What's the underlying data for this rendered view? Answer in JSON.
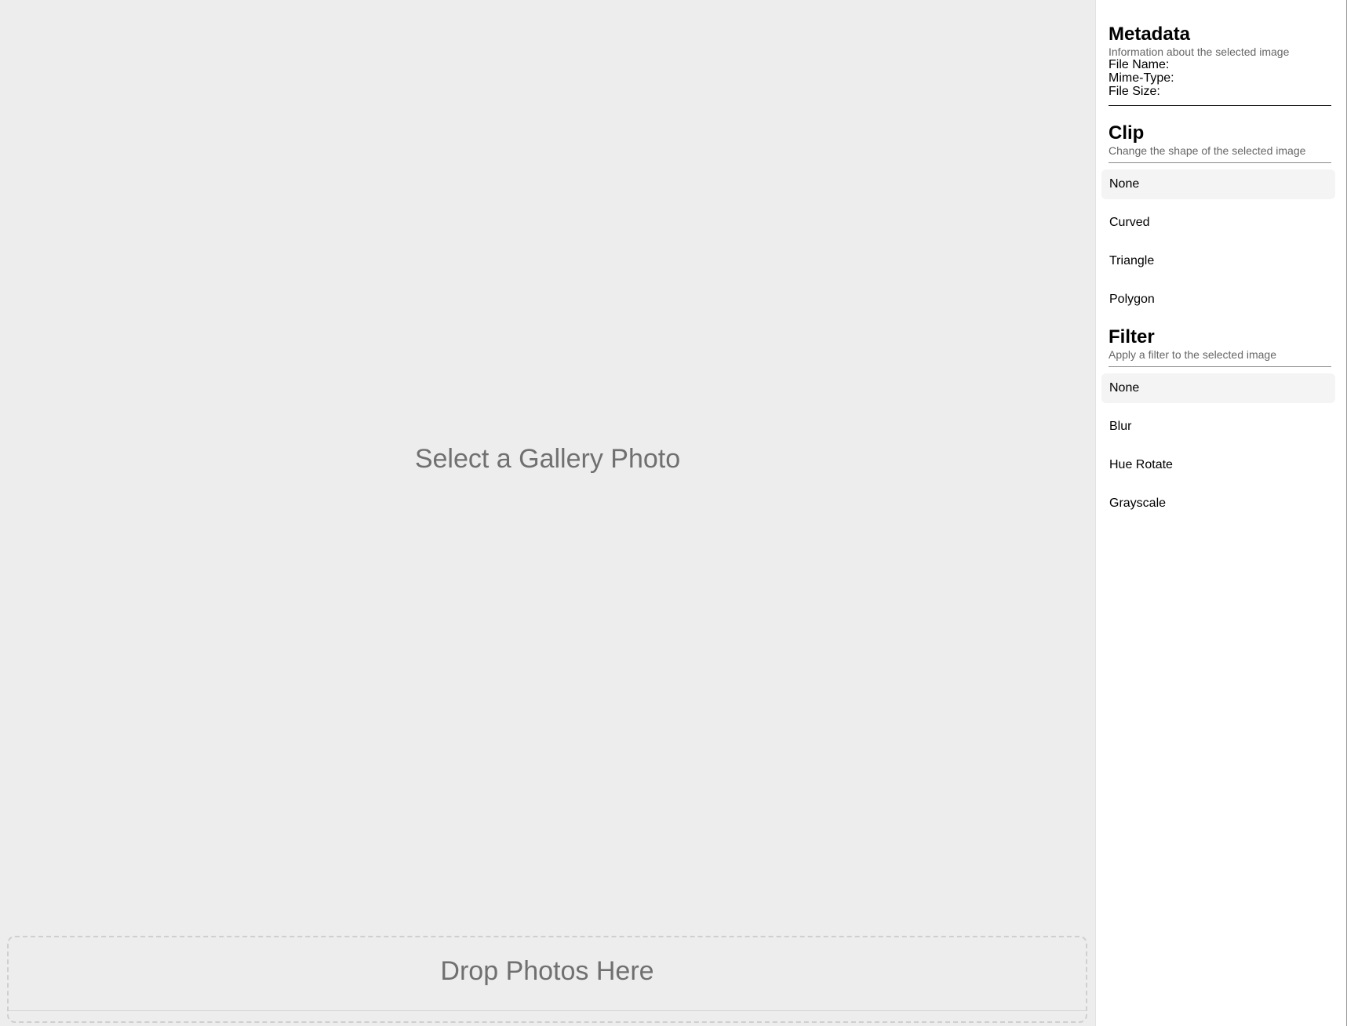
{
  "viewer": {
    "placeholder": "Select a Gallery Photo",
    "dropzone_label": "Drop Photos Here"
  },
  "sidebar": {
    "metadata": {
      "title": "Metadata",
      "subtitle": "Information about the selected image",
      "file_name_label": "File Name:",
      "mime_type_label": "Mime-Type:",
      "file_size_label": "File Size:"
    },
    "clip": {
      "title": "Clip",
      "subtitle": "Change the shape of the selected image",
      "options": [
        "None",
        "Curved",
        "Triangle",
        "Polygon"
      ],
      "selected": "None"
    },
    "filter": {
      "title": "Filter",
      "subtitle": "Apply a filter to the selected image",
      "options": [
        "None",
        "Blur",
        "Hue Rotate",
        "Grayscale"
      ],
      "selected": "None"
    }
  },
  "colors": {
    "viewer_bg": "#ededed",
    "placeholder_text": "#707070",
    "selected_option_bg": "#f4f4f4"
  }
}
